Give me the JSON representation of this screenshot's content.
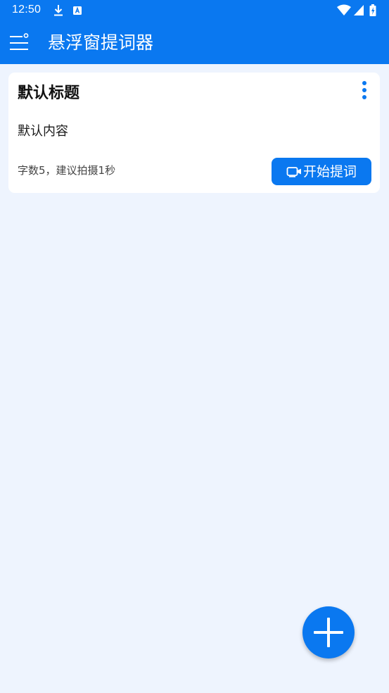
{
  "status_bar": {
    "time": "12:50",
    "icons": [
      "download-icon",
      "a-notification-icon",
      "wifi-icon",
      "signal-icon",
      "battery-charging-icon"
    ]
  },
  "app_bar": {
    "menu_icon": "menu-icon",
    "title": "悬浮窗提词器"
  },
  "scripts": [
    {
      "title": "默认标题",
      "content": "默认内容",
      "stats": "字数5，建议拍摄1秒",
      "more_icon": "more-vertical-icon",
      "start_button": {
        "icon": "video-camera-icon",
        "label": "开始提词"
      }
    }
  ],
  "fab": {
    "icon": "add-icon"
  },
  "colors": {
    "primary": "#0A78F0",
    "background": "#EEF4FE",
    "card": "#FFFFFF"
  }
}
